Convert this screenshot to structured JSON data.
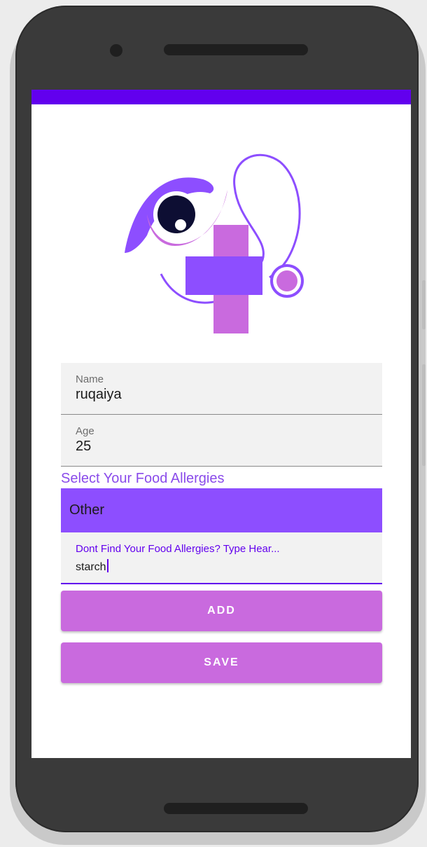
{
  "form": {
    "name_label": "Name",
    "name_value": "ruqaiya",
    "age_label": "Age",
    "age_value": "25",
    "allergy_heading": "Select Your Food Allergies",
    "allergy_selected": "Other",
    "other_label": "Dont Find Your Food Allergies? Type Hear...",
    "other_value": "starch",
    "add_label": "ADD",
    "save_label": "SAVE"
  },
  "colors": {
    "status_bar": "#6200ee",
    "accent": "#8d4eff",
    "button": "#c96ade",
    "heading": "#8a4bea"
  },
  "icons": {
    "logo": "eye-medical-cross-stethoscope-logo"
  }
}
